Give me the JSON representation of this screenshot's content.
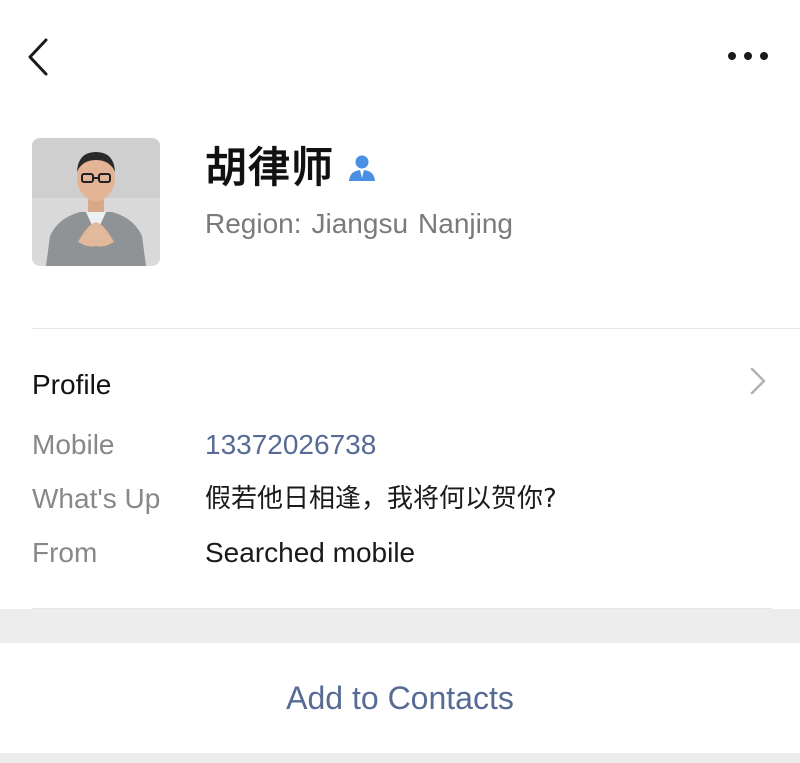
{
  "header": {
    "name": "胡律师",
    "region_label": "Region:",
    "region_province": "Jiangsu",
    "region_city": "Nanjing"
  },
  "icons": {
    "back": "chevron-left-icon",
    "more": "more-dots-icon",
    "verified": "person-verified-icon",
    "profile_chevron": "chevron-right-icon"
  },
  "profile": {
    "title": "Profile",
    "rows": [
      {
        "label": "Mobile",
        "value": "13372026738"
      },
      {
        "label": "What's Up",
        "value": "假若他日相逢，我将何以贺你?"
      },
      {
        "label": "From",
        "value": "Searched mobile"
      }
    ]
  },
  "actions": {
    "add_to_contacts": "Add to Contacts"
  },
  "colors": {
    "link": "#576b95",
    "verified": "#4a90e2",
    "label_gray": "#888888",
    "background_band": "#ededed"
  }
}
